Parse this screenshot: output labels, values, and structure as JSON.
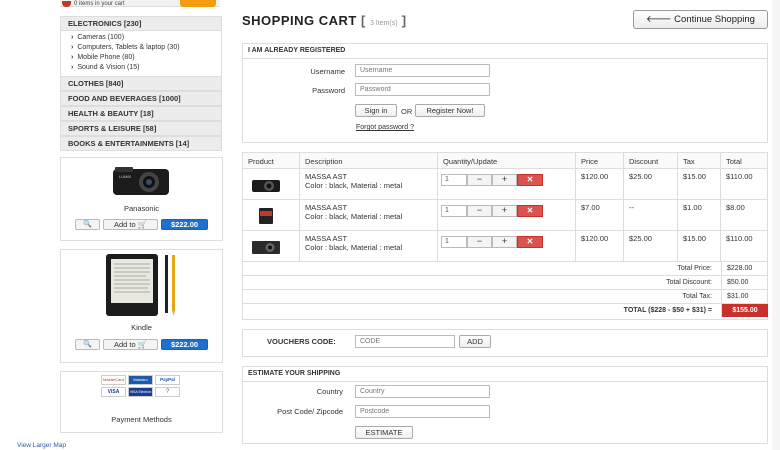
{
  "topbar": {
    "cart_text": "0 items in your cart"
  },
  "sidebar": {
    "categories": [
      {
        "label": "ELECTRONICS [230]",
        "sub": [
          "Cameras (100)",
          "Computers, Tablets & laptop (30)",
          "Mobile Phone (80)",
          "Sound & Vision (15)"
        ]
      },
      {
        "label": "CLOTHES [840]"
      },
      {
        "label": "FOOD AND BEVERAGES [1000]"
      },
      {
        "label": "HEALTH & BEAUTY [18]"
      },
      {
        "label": "SPORTS & LEISURE [58]"
      },
      {
        "label": "BOOKS & ENTERTAINMENTS [14]"
      }
    ],
    "products": [
      {
        "name": "Panasonic",
        "zoom_label": "🔍",
        "add_label": "Add to 🛒",
        "price": "$222.00"
      },
      {
        "name": "Kindle",
        "zoom_label": "🔍",
        "add_label": "Add to 🛒",
        "price": "$222.00"
      }
    ],
    "payment": {
      "label": "Payment Methods",
      "cards": [
        "MasterCard",
        "Maestro",
        "PayPal",
        "VISA",
        "VISA Electron",
        "?"
      ]
    },
    "map_link": "View Larger Map"
  },
  "main": {
    "title": "SHOPPING CART",
    "item_count": "3 Item(s)",
    "continue_label": "Continue Shopping",
    "continue_icon": "arrow-left-icon",
    "login": {
      "heading": "I AM ALREADY REGISTERED",
      "username_label": "Username",
      "username_placeholder": "Username",
      "password_label": "Password",
      "password_placeholder": "Password",
      "signin_label": "Sign in",
      "or_label": "OR",
      "register_label": "Register Now!",
      "forgot_label": "Forgot password ?"
    },
    "cart": {
      "headers": [
        "Product",
        "Description",
        "Quantity/Update",
        "Price",
        "Discount",
        "Tax",
        "Total"
      ],
      "rows": [
        {
          "title": "MASSA AST",
          "detail": "Color : black, Material : metal",
          "qty": "1",
          "price": "$120.00",
          "discount": "$25.00",
          "tax": "$15.00",
          "total": "$110.00"
        },
        {
          "title": "MASSA AST",
          "detail": "Color : black, Material : metal",
          "qty": "1",
          "price": "$7.00",
          "discount": "--",
          "tax": "$1.00",
          "total": "$8.00"
        },
        {
          "title": "MASSA AST",
          "detail": "Color : black, Material : metal",
          "qty": "1",
          "price": "$120.00",
          "discount": "$25.00",
          "tax": "$15.00",
          "total": "$110.00"
        }
      ],
      "qty_minus": "−",
      "qty_plus": "+",
      "qty_remove": "✕",
      "summary": [
        {
          "label": "Total Price:",
          "value": "$228.00"
        },
        {
          "label": "Total Discount:",
          "value": "$50.00"
        },
        {
          "label": "Total Tax:",
          "value": "$31.00"
        }
      ],
      "grand": {
        "label": "TOTAL ($228 - $50 + $31) =",
        "value": "$155.00"
      }
    },
    "voucher": {
      "label": "VOUCHERS CODE:",
      "placeholder": "CODE",
      "button": "ADD"
    },
    "shipping": {
      "heading": "ESTIMATE YOUR SHIPPING",
      "country_label": "Country",
      "country_placeholder": "Country",
      "postcode_label": "Post Code/ Zipcode",
      "postcode_placeholder": "Postcode",
      "button": "ESTIMATE"
    }
  }
}
